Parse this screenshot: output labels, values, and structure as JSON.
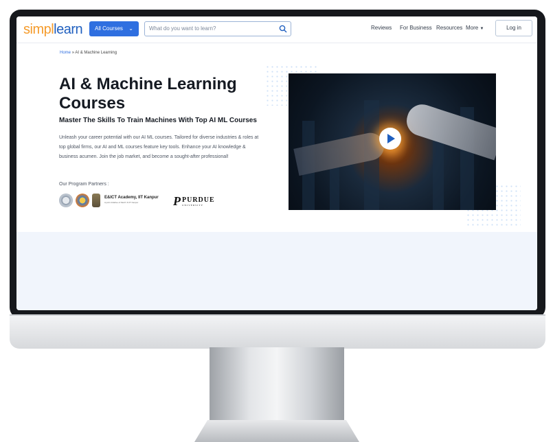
{
  "nav": {
    "logo_part1": "simpl",
    "logo_part2": "learn",
    "all_courses": "All Courses",
    "search_placeholder": "What do you want to learn?",
    "links": [
      "Reviews",
      "For Business",
      "Resources",
      "More"
    ],
    "login": "Log in"
  },
  "breadcrumb": {
    "home": "Home",
    "separator": "»",
    "current": "AI & Machine Learning"
  },
  "hero": {
    "title": "AI & Machine Learning Courses",
    "subtitle": "Master The Skills To Train Machines With Top AI ML Courses",
    "description": "Unleash your career potential with our AI ML courses. Tailored for diverse industries & roles at top global firms, our AI and ML courses feature key tools. Enhance your AI knowledge & business acumen. Join the job market, and become a sought-after professional!",
    "partners_label": "Our Program Partners :",
    "partner_eict": "E&ICT Academy, IIT Kanpur",
    "partner_eict_sub": "A joint initiative of MeitY & IIT Kanpur",
    "partner_purdue_1": "PURDUE",
    "partner_purdue_2": "UNIVERSITY"
  },
  "colors": {
    "accent": "#2f6fe0",
    "logo_orange": "#f59b2b",
    "logo_blue": "#1f5fbf"
  },
  "icons": [
    "search-icon",
    "chevron-down-icon",
    "play-icon"
  ]
}
